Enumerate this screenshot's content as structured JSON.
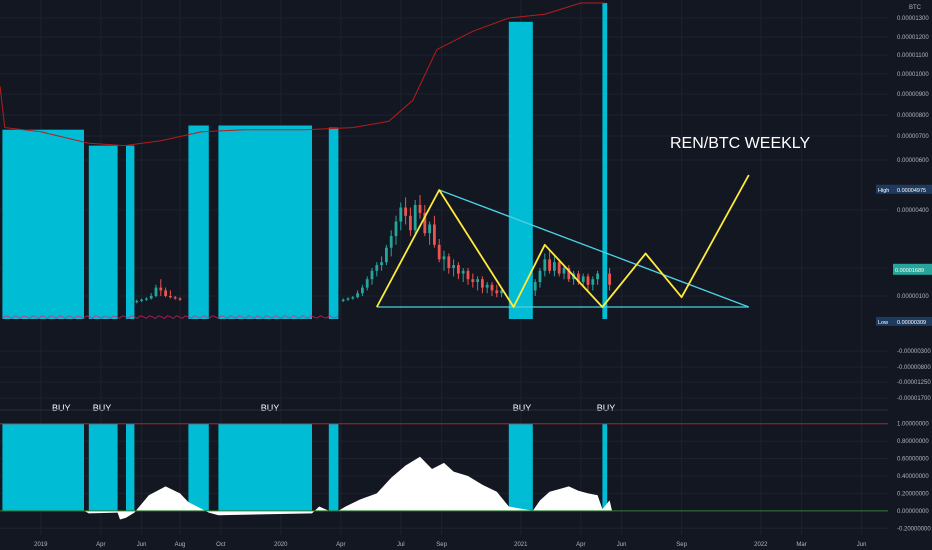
{
  "chart_data": {
    "type": "candlestick",
    "title": "REN/BTC WEEKLY",
    "quote_currency": "BTC",
    "colors": {
      "background": "#131722",
      "up_candle": "#26a69a",
      "down_candle": "#ef5350",
      "highlight_bars": "#00bcd4",
      "pattern_lines": "#ffeb3b",
      "trendlines": "#4dd0e1",
      "envelope_line": "#b71c1c",
      "oscillator_fill": "#ffffff",
      "upper_level": "#b71c1c",
      "zero_level": "#2e7d32"
    },
    "x_ticks": [
      "2019",
      "Apr",
      "Jun",
      "Aug",
      "Oct",
      "2020",
      "Apr",
      "Jul",
      "Sep",
      "2021",
      "Apr",
      "Jun",
      "Sep",
      "2022",
      "Mar",
      "Jun"
    ],
    "x_tick_positions": [
      2019.0,
      2019.25,
      2019.42,
      2019.58,
      2019.75,
      2020.0,
      2020.25,
      2020.5,
      2020.67,
      2021.0,
      2021.25,
      2021.42,
      2021.67,
      2022.0,
      2022.17,
      2022.42
    ],
    "price_axis": {
      "ylim": [
        -1.85e-05,
        1.42e-05
      ],
      "tick_labels": [
        "0.00001300",
        "0.00001200",
        "0.00001100",
        "0.00001000",
        "0.00000900",
        "0.00000800",
        "0.00000700",
        "0.00000600",
        "0.00000400",
        "0.00000200",
        "0.00000100",
        "-0.00000300",
        "-0.00000800",
        "-0.00001250",
        "-0.00001700"
      ],
      "tick_values": [
        1.3e-05,
        1.2e-05,
        1.1e-05,
        1e-05,
        9e-06,
        8e-06,
        7e-06,
        6e-06,
        4e-06,
        2e-06,
        1e-06,
        -3e-06,
        -8e-06,
        -1.25e-05,
        -1.7e-05
      ],
      "high_label": "High",
      "high_value": "0.00004975",
      "high_level": 4.81e-06,
      "low_label": "Low",
      "low_value": "0.00000309",
      "low_level": -9.5e-07,
      "current_value": "0.00001689",
      "current_level": 1.9e-06
    },
    "envelope_line": [
      [
        2018.83,
        9.4e-06
      ],
      [
        2018.85,
        7.4e-06
      ],
      [
        2019.0,
        7.2e-06
      ],
      [
        2019.2,
        6.7e-06
      ],
      [
        2019.35,
        6.6e-06
      ],
      [
        2019.5,
        6.8e-06
      ],
      [
        2019.67,
        7.2e-06
      ],
      [
        2019.85,
        7.3e-06
      ],
      [
        2020.1,
        7.3e-06
      ],
      [
        2020.3,
        7.4e-06
      ],
      [
        2020.45,
        7.7e-06
      ],
      [
        2020.55,
        8.7e-06
      ],
      [
        2020.65,
        1.13e-05
      ],
      [
        2020.8,
        1.23e-05
      ],
      [
        2020.95,
        1.3e-05
      ],
      [
        2021.1,
        1.33e-05
      ],
      [
        2021.25,
        1.42e-05
      ],
      [
        2021.35,
        1.43e-05
      ]
    ],
    "highlight_regions": [
      {
        "x0": 2018.84,
        "x1": 2019.18,
        "top": 7.3e-06
      },
      {
        "x0": 2019.2,
        "x1": 2019.32,
        "top": 6.6e-06
      },
      {
        "x0": 2019.355,
        "x1": 2019.39,
        "top": 6.6e-06
      },
      {
        "x0": 2019.615,
        "x1": 2019.7,
        "top": 7.5e-06
      },
      {
        "x0": 2019.74,
        "x1": 2020.13,
        "top": 7.5e-06
      },
      {
        "x0": 2020.2,
        "x1": 2020.24,
        "top": 7.4e-06
      },
      {
        "x0": 2020.95,
        "x1": 2021.05,
        "top": 1.28e-05
      },
      {
        "x0": 2021.34,
        "x1": 2021.36,
        "top": 1.42e-05
      }
    ],
    "ohlc": [
      [
        2019.38,
        4e-07,
        6e-07,
        3e-07,
        5e-07
      ],
      [
        2019.4,
        5e-07,
        7e-07,
        4e-07,
        6e-07
      ],
      [
        2019.42,
        6e-07,
        8e-07,
        5e-07,
        7e-07
      ],
      [
        2019.44,
        7e-07,
        9e-07,
        6e-07,
        8e-07
      ],
      [
        2019.46,
        8e-07,
        1.1e-06,
        7e-07,
        1e-06
      ],
      [
        2019.48,
        1e-06,
        1.4e-06,
        9e-07,
        1.3e-06
      ],
      [
        2019.5,
        1.3e-06,
        1.6e-06,
        1e-06,
        1.2e-06
      ],
      [
        2019.52,
        1.2e-06,
        1.3e-06,
        9e-07,
        1e-06
      ],
      [
        2019.54,
        1e-06,
        1.2e-06,
        8e-07,
        9e-07
      ],
      [
        2019.56,
        9e-07,
        1e-06,
        7e-07,
        8e-07
      ],
      [
        2019.58,
        8e-07,
        9e-07,
        6e-07,
        7e-07
      ],
      [
        2020.26,
        6e-07,
        8e-07,
        5e-07,
        7e-07
      ],
      [
        2020.28,
        7e-07,
        9e-07,
        6e-07,
        8e-07
      ],
      [
        2020.3,
        8e-07,
        1e-06,
        7e-07,
        9e-07
      ],
      [
        2020.32,
        9e-07,
        1.2e-06,
        8e-07,
        1.1e-06
      ],
      [
        2020.34,
        1.1e-06,
        1.4e-06,
        1e-06,
        1.3e-06
      ],
      [
        2020.36,
        1.3e-06,
        1.7e-06,
        1.2e-06,
        1.6e-06
      ],
      [
        2020.38,
        1.6e-06,
        2e-06,
        1.4e-06,
        1.9e-06
      ],
      [
        2020.4,
        1.9e-06,
        2.2e-06,
        1.7e-06,
        2.1e-06
      ],
      [
        2020.42,
        2.1e-06,
        2.4e-06,
        1.9e-06,
        2.2e-06
      ],
      [
        2020.44,
        2.2e-06,
        2.8e-06,
        2.1e-06,
        2.7e-06
      ],
      [
        2020.46,
        2.7e-06,
        3.3e-06,
        2.4e-06,
        3.1e-06
      ],
      [
        2020.48,
        3.1e-06,
        3.8e-06,
        2.8e-06,
        3.6e-06
      ],
      [
        2020.5,
        3.6e-06,
        4.3e-06,
        3.3e-06,
        4.1e-06
      ],
      [
        2020.52,
        4.1e-06,
        4.5e-06,
        3.5e-06,
        3.8e-06
      ],
      [
        2020.54,
        3.8e-06,
        4.1e-06,
        3.1e-06,
        3.3e-06
      ],
      [
        2020.56,
        3.3e-06,
        4.4e-06,
        3.2e-06,
        4.2e-06
      ],
      [
        2020.58,
        4.2e-06,
        4.6e-06,
        3.7e-06,
        3.9e-06
      ],
      [
        2020.6,
        3.9e-06,
        4.2e-06,
        3.1e-06,
        3.2e-06
      ],
      [
        2020.62,
        3.2e-06,
        3.6e-06,
        2.8e-06,
        3.5e-06
      ],
      [
        2020.64,
        3.5e-06,
        3.8e-06,
        2.7e-06,
        2.8e-06
      ],
      [
        2020.66,
        2.8e-06,
        3e-06,
        2.2e-06,
        2.3e-06
      ],
      [
        2020.68,
        2.3e-06,
        2.6e-06,
        1.9e-06,
        2.4e-06
      ],
      [
        2020.7,
        2.4e-06,
        2.5e-06,
        1.8e-06,
        2e-06
      ],
      [
        2020.72,
        2e-06,
        2.3e-06,
        1.7e-06,
        2.1e-06
      ],
      [
        2020.74,
        2.1e-06,
        2.2e-06,
        1.6e-06,
        1.8e-06
      ],
      [
        2020.76,
        1.8e-06,
        2e-06,
        1.5e-06,
        1.9e-06
      ],
      [
        2020.78,
        1.9e-06,
        2e-06,
        1.4e-06,
        1.6e-06
      ],
      [
        2020.8,
        1.6e-06,
        1.8e-06,
        1.3e-06,
        1.5e-06
      ],
      [
        2020.82,
        1.5e-06,
        1.7e-06,
        1.2e-06,
        1.6e-06
      ],
      [
        2020.84,
        1.6e-06,
        1.7e-06,
        1.1e-06,
        1.3e-06
      ],
      [
        2020.86,
        1.3e-06,
        1.5e-06,
        1.1e-06,
        1.4e-06
      ],
      [
        2020.88,
        1.4e-06,
        1.5e-06,
        1e-06,
        1.2e-06
      ],
      [
        2020.9,
        1.2e-06,
        1.4e-06,
        9e-07,
        1.1e-06
      ],
      [
        2020.92,
        1.1e-06,
        1.3e-06,
        9e-07,
        1.2e-06
      ],
      [
        2021.06,
        1.2e-06,
        1.6e-06,
        1e-06,
        1.5e-06
      ],
      [
        2021.08,
        1.5e-06,
        2e-06,
        1.3e-06,
        1.9e-06
      ],
      [
        2021.1,
        1.9e-06,
        2.5e-06,
        1.7e-06,
        2.3e-06
      ],
      [
        2021.12,
        2.3e-06,
        2.6e-06,
        1.8e-06,
        1.9e-06
      ],
      [
        2021.14,
        1.9e-06,
        2.4e-06,
        1.7e-06,
        2.2e-06
      ],
      [
        2021.16,
        2.2e-06,
        2.3e-06,
        1.7e-06,
        1.8e-06
      ],
      [
        2021.18,
        1.8e-06,
        2.1e-06,
        1.6e-06,
        2e-06
      ],
      [
        2021.2,
        2e-06,
        2.1e-06,
        1.5e-06,
        1.6e-06
      ],
      [
        2021.22,
        1.6e-06,
        1.9e-06,
        1.4e-06,
        1.8e-06
      ],
      [
        2021.24,
        1.8e-06,
        1.9e-06,
        1.4e-06,
        1.5e-06
      ],
      [
        2021.26,
        1.5e-06,
        1.8e-06,
        1.3e-06,
        1.7e-06
      ],
      [
        2021.28,
        1.7e-06,
        1.8e-06,
        1.2e-06,
        1.4e-06
      ],
      [
        2021.3,
        1.4e-06,
        1.7e-06,
        1.2e-06,
        1.6e-06
      ],
      [
        2021.32,
        1.6e-06,
        1.9e-06,
        1.4e-06,
        1.8e-06
      ],
      [
        2021.37,
        1.8e-06,
        2e-06,
        1.2e-06,
        1.4e-06
      ]
    ],
    "pattern_line": [
      [
        2020.4,
        1e-07
      ],
      [
        2020.66,
        4.8e-06
      ],
      [
        2020.97,
        1e-07
      ],
      [
        2021.1,
        2.8e-06
      ],
      [
        2021.34,
        1e-07
      ],
      [
        2021.52,
        2.5e-06
      ],
      [
        2021.67,
        9e-07
      ],
      [
        2021.95,
        5.4e-06
      ]
    ],
    "descending_trendline": [
      [
        2020.66,
        4.8e-06
      ],
      [
        2021.95,
        1e-07
      ]
    ],
    "support_line": [
      [
        2020.4,
        1e-07
      ],
      [
        2021.95,
        1e-07
      ]
    ],
    "volume_baseline": 1e-07,
    "oscillator": {
      "ylim": [
        -0.22,
        1.1
      ],
      "tick_labels": [
        "1.00000000",
        "0.80000000",
        "0.60000000",
        "0.40000000",
        "0.20000000",
        "0.00000000",
        "-0.20000000"
      ],
      "tick_values": [
        1.0,
        0.8,
        0.6,
        0.4,
        0.2,
        0.0,
        -0.2
      ],
      "upper_level": 1.0,
      "zero_level": 0.0,
      "buy_labels": [
        {
          "text": "BUY",
          "x": 2019.08
        },
        {
          "text": "BUY",
          "x": 2019.25
        },
        {
          "text": "BUY",
          "x": 2019.95
        },
        {
          "text": "BUY",
          "x": 2021.0
        },
        {
          "text": "BUY",
          "x": 2021.35
        }
      ],
      "highlight_regions": [
        {
          "x0": 2018.84,
          "x1": 2019.18
        },
        {
          "x0": 2019.2,
          "x1": 2019.32
        },
        {
          "x0": 2019.355,
          "x1": 2019.39
        },
        {
          "x0": 2019.615,
          "x1": 2019.7
        },
        {
          "x0": 2019.74,
          "x1": 2020.13
        },
        {
          "x0": 2020.2,
          "x1": 2020.24
        },
        {
          "x0": 2020.95,
          "x1": 2021.05
        },
        {
          "x0": 2021.34,
          "x1": 2021.36
        }
      ],
      "series": [
        [
          2018.84,
          0.0
        ],
        [
          2019.18,
          0.0
        ],
        [
          2019.2,
          -0.03
        ],
        [
          2019.32,
          -0.02
        ],
        [
          2019.33,
          -0.1
        ],
        [
          2019.355,
          -0.08
        ],
        [
          2019.39,
          -0.02
        ],
        [
          2019.45,
          0.18
        ],
        [
          2019.52,
          0.28
        ],
        [
          2019.58,
          0.2
        ],
        [
          2019.615,
          0.1
        ],
        [
          2019.7,
          -0.02
        ],
        [
          2019.74,
          -0.05
        ],
        [
          2020.13,
          -0.03
        ],
        [
          2020.16,
          0.05
        ],
        [
          2020.2,
          0.0
        ],
        [
          2020.24,
          0.0
        ],
        [
          2020.27,
          0.05
        ],
        [
          2020.33,
          0.13
        ],
        [
          2020.4,
          0.2
        ],
        [
          2020.46,
          0.38
        ],
        [
          2020.52,
          0.52
        ],
        [
          2020.58,
          0.62
        ],
        [
          2020.63,
          0.48
        ],
        [
          2020.68,
          0.55
        ],
        [
          2020.72,
          0.45
        ],
        [
          2020.78,
          0.4
        ],
        [
          2020.84,
          0.3
        ],
        [
          2020.9,
          0.22
        ],
        [
          2020.95,
          0.05
        ],
        [
          2021.05,
          0.0
        ],
        [
          2021.08,
          0.12
        ],
        [
          2021.12,
          0.22
        ],
        [
          2021.16,
          0.25
        ],
        [
          2021.2,
          0.28
        ],
        [
          2021.24,
          0.23
        ],
        [
          2021.28,
          0.2
        ],
        [
          2021.32,
          0.18
        ],
        [
          2021.34,
          0.02
        ],
        [
          2021.37,
          0.12
        ],
        [
          2021.38,
          0.0
        ]
      ]
    }
  }
}
